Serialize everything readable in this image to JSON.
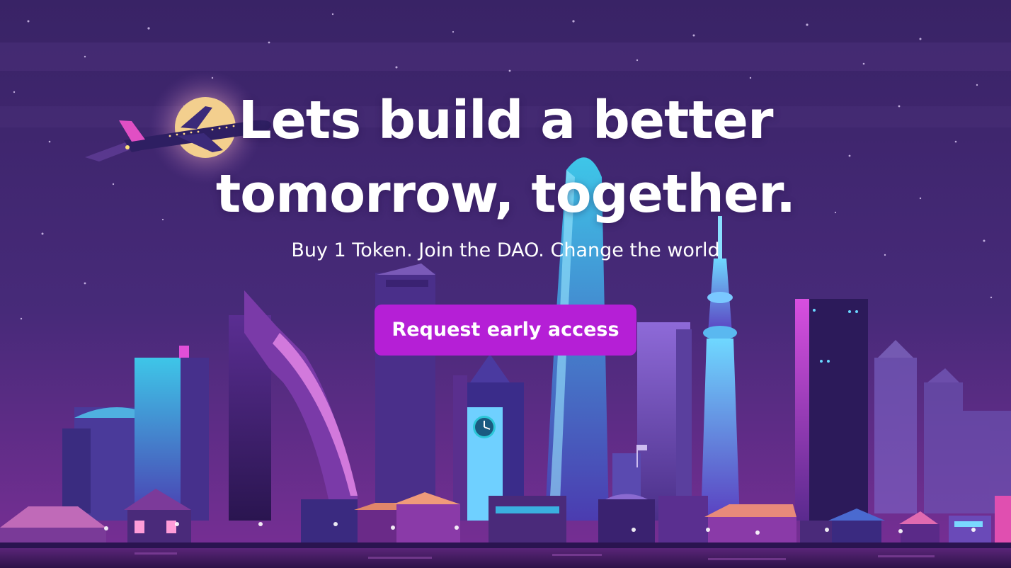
{
  "hero": {
    "headline_line1": "Lets build a better",
    "headline_line2": "tomorrow, together.",
    "subheadline": "Buy 1 Token. Join the DAO. Change the world",
    "cta_label": "Request early access"
  },
  "colors": {
    "cta_background": "#b51fd6",
    "sky_top": "#3b2466",
    "sky_bottom": "#6b2f91",
    "text": "#ffffff"
  },
  "illustration": {
    "subject": "night-city-skyline",
    "elements": [
      "moon-icon",
      "airplane-icon",
      "clock-tower-icon",
      "tv-tower-icon"
    ]
  }
}
